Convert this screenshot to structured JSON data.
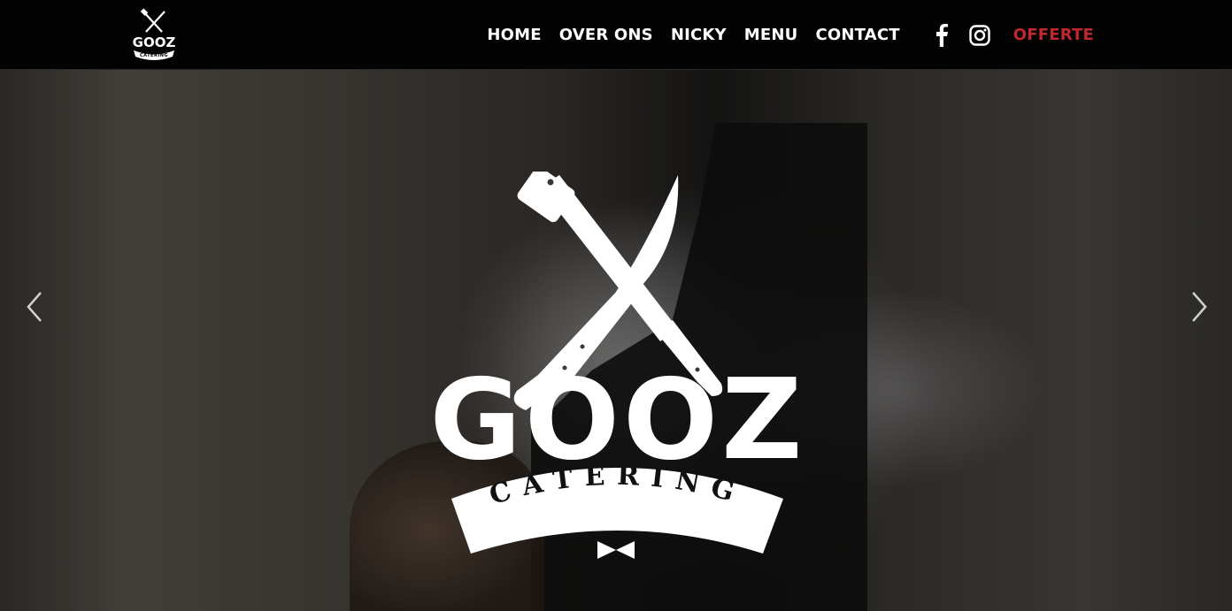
{
  "header": {
    "logo": {
      "title": "GOOZ",
      "subtitle": "CATERING"
    },
    "nav": [
      {
        "label": "HOME"
      },
      {
        "label": "OVER ONS"
      },
      {
        "label": "NICKY"
      },
      {
        "label": "MENU"
      },
      {
        "label": "CONTACT"
      }
    ],
    "social": [
      {
        "icon": "facebook-icon"
      },
      {
        "icon": "instagram-icon"
      }
    ],
    "cta_label": "OFFERTE",
    "colors": {
      "background": "#030303",
      "text": "#ffffff",
      "accent": "#c1272d"
    }
  },
  "hero": {
    "logo": {
      "title": "GOOZ",
      "subtitle": "CATERING"
    },
    "prev_icon": "chevron-left-icon",
    "next_icon": "chevron-right-icon"
  }
}
